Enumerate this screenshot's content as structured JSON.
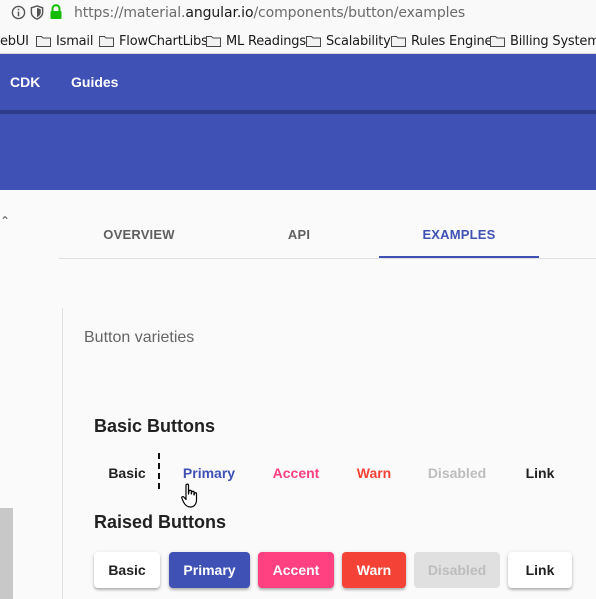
{
  "browser": {
    "url_prefix": "https://material.",
    "url_host": "angular.io",
    "url_path": "/components/button/examples",
    "bookmarks": [
      "ebUI",
      "Ismail",
      "FlowChartLibs",
      "ML Readings",
      "Scalability",
      "Rules Engine",
      "Billing System"
    ]
  },
  "toolbar": {
    "nav": [
      "CDK",
      "Guides"
    ]
  },
  "tabs": [
    "OVERVIEW",
    "API",
    "EXAMPLES"
  ],
  "active_tab": "EXAMPLES",
  "example": {
    "title": "Button varieties",
    "basic_title": "Basic Buttons",
    "raised_title": "Raised Buttons",
    "buttons": [
      "Basic",
      "Primary",
      "Accent",
      "Warn",
      "Disabled",
      "Link"
    ]
  },
  "colors": {
    "primary": "#3f51b5",
    "accent": "#ff4081",
    "warn": "#f44336",
    "disabled_bg": "#e0e0e0",
    "disabled_text": "#bdbdbd"
  }
}
